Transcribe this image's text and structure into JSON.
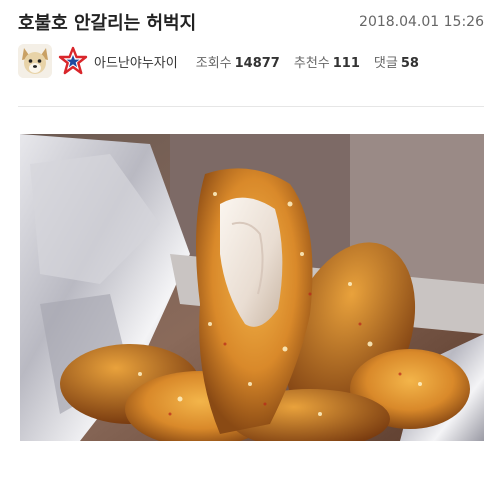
{
  "post": {
    "title": "호불호 안갈리는 허벅지",
    "date": "2018.04.01 15:26",
    "author": {
      "nickname": "아드난야누자이",
      "avatar_icon": "dog-avatar-icon",
      "rank_icon": "star-rank-icon"
    },
    "stats": {
      "views_label": "조회수",
      "views": "14877",
      "likes_label": "추천수",
      "likes": "111",
      "comments_label": "댓글",
      "comments": "58"
    }
  },
  "colors": {
    "title": "#222222",
    "meta": "#666666",
    "divider": "#e6e6e6",
    "rank_star_red": "#d9262b",
    "rank_star_blue": "#1f4aa0"
  }
}
